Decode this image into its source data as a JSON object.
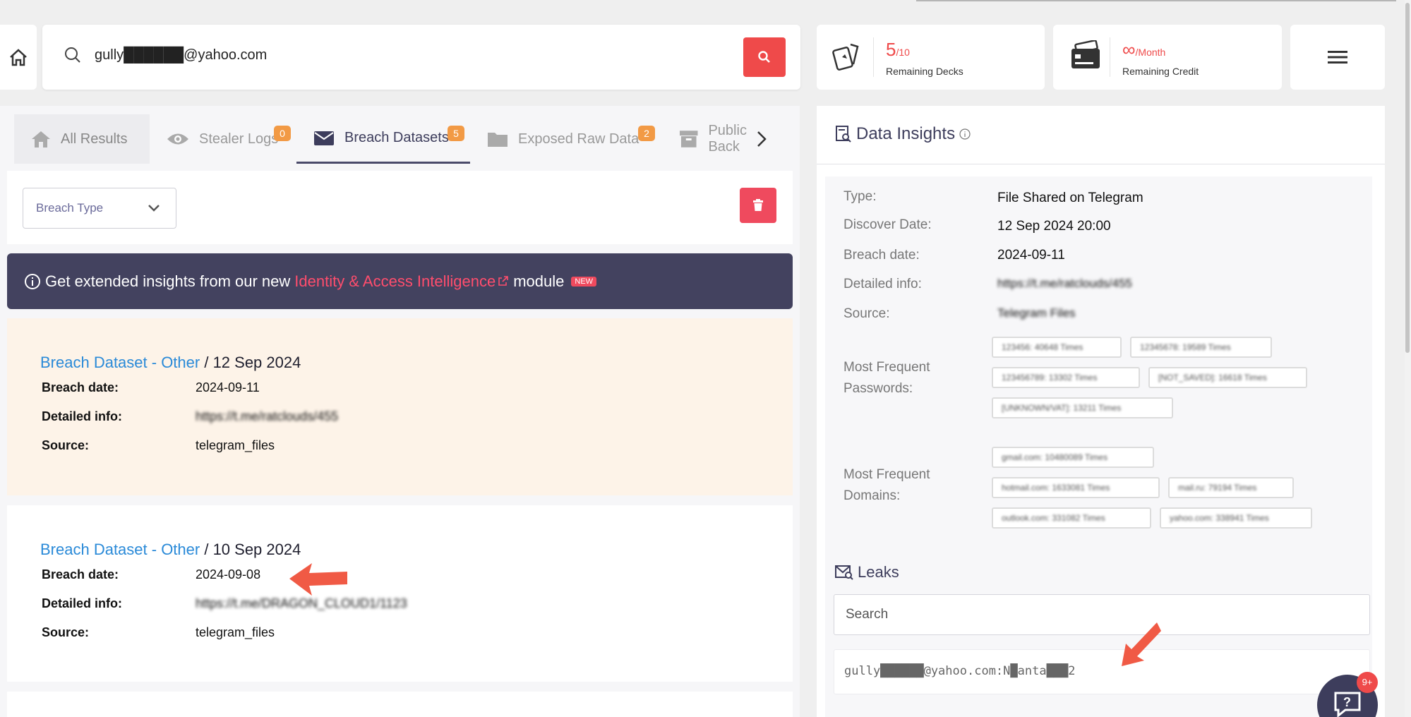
{
  "search": {
    "query": "gully██████@yahoo.com"
  },
  "stats": {
    "decks_value": "5",
    "decks_total": "/10",
    "decks_label": "Remaining Decks",
    "credit_value": "∞",
    "credit_unit": "/Month",
    "credit_label": "Remaining Credit"
  },
  "tabs": [
    {
      "label": "All Results",
      "badge": ""
    },
    {
      "label": "Stealer Logs",
      "badge": "0"
    },
    {
      "label": "Breach Datasets",
      "badge": "5"
    },
    {
      "label": "Exposed Raw Data",
      "badge": "2"
    },
    {
      "label": "Public Back",
      "badge": ""
    }
  ],
  "filter": {
    "breach_type": "Breach Type"
  },
  "banner": {
    "pre": "Get extended insights from our new",
    "link": "Identity & Access Intelligence",
    "post": "module",
    "new": "NEW"
  },
  "results": [
    {
      "type": "Breach Dataset - Other",
      "date": "/ 12 Sep 2024",
      "breach_label": "Breach date:",
      "breach_date": "2024-09-11",
      "info_label": "Detailed info:",
      "info": "https://t.me/ratclouds/455",
      "source_label": "Source:",
      "source": "telegram_files"
    },
    {
      "type": "Breach Dataset - Other",
      "date": "/ 10 Sep 2024",
      "breach_label": "Breach date:",
      "breach_date": "2024-09-08",
      "info_label": "Detailed info:",
      "info": "https://t.me/DRAGON_CLOUD1/1123",
      "source_label": "Source:",
      "source": "telegram_files"
    }
  ],
  "insights": {
    "title": "Data Insights",
    "type_label": "Type:",
    "type": "File Shared on Telegram",
    "discover_label": "Discover Date:",
    "discover": "12 Sep 2024 20:00",
    "breach_label": "Breach date:",
    "breach": "2024-09-11",
    "detail_label": "Detailed info:",
    "detail": "https://t.me/ratclouds/455",
    "source_label": "Source:",
    "source": "Telegram Files",
    "passwords_label": "Most Frequent Passwords:",
    "passwords": [
      "123456: 40648 Times",
      "12345678: 19589 Times",
      "123456789: 13302 Times",
      "[NOT_SAVED]: 16618 Times",
      "[UNKNOWN/VAT]: 13211 Times"
    ],
    "domains_label": "Most Frequent Domains:",
    "domains": [
      "gmail.com: 10480089 Times",
      "hotmail.com: 1633081 Times",
      "mail.ru: 79194 Times",
      "outlook.com: 331082 Times",
      "yahoo.com: 338941 Times"
    ]
  },
  "leaks": {
    "title": "Leaks",
    "search_placeholder": "Search",
    "entry": "gully██████@yahoo.com:N█anta███2"
  },
  "chat": {
    "count": "9+"
  },
  "colors": {
    "accent": "#ef4a4a",
    "dark": "#43425f",
    "link": "#2a8ad8",
    "badge": "#f29a45"
  }
}
